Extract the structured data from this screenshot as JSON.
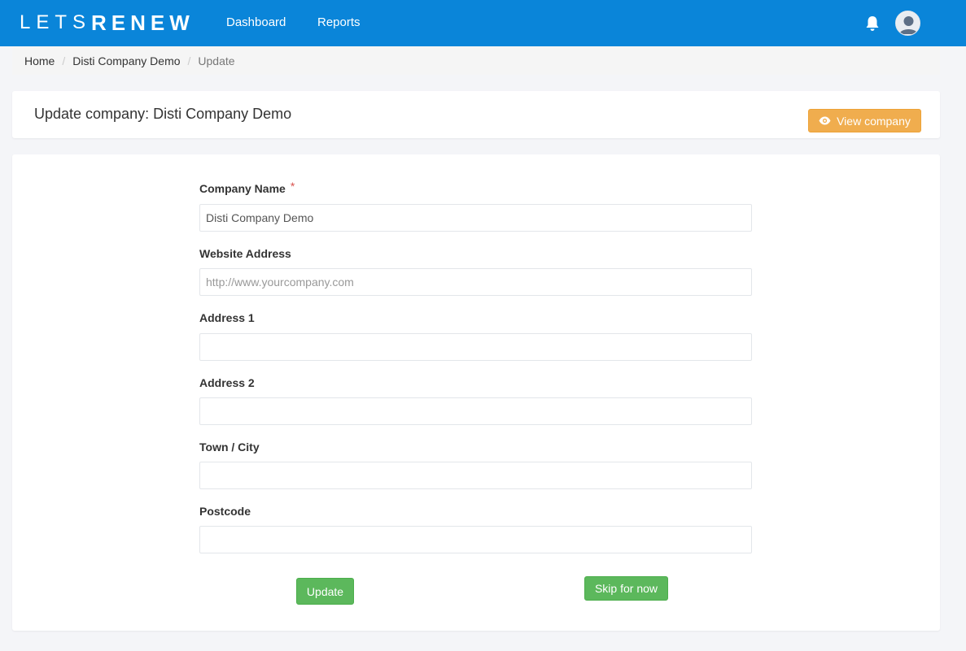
{
  "brand": {
    "part1": "LETS",
    "part2": "RENEW"
  },
  "nav": {
    "dashboard": "Dashboard",
    "reports": "Reports"
  },
  "icons": {
    "bell": "bell-icon",
    "avatar": "user-avatar-icon",
    "eye": "eye-icon"
  },
  "colors": {
    "navbar": "#0a85d9",
    "warning": "#f0ad4e",
    "success": "#5cb85c",
    "required": "#d9534f"
  },
  "breadcrumb": {
    "home": "Home",
    "company": "Disti Company Demo",
    "current": "Update"
  },
  "page": {
    "title": "Update company: Disti Company Demo",
    "view_button": "View company"
  },
  "form": {
    "company_name": {
      "label": "Company Name",
      "required_mark": "*",
      "value": "Disti Company Demo",
      "placeholder": ""
    },
    "website": {
      "label": "Website Address",
      "value": "",
      "placeholder": "http://www.yourcompany.com"
    },
    "address1": {
      "label": "Address 1",
      "value": "",
      "placeholder": ""
    },
    "address2": {
      "label": "Address 2",
      "value": "",
      "placeholder": ""
    },
    "town": {
      "label": "Town / City",
      "value": "",
      "placeholder": ""
    },
    "postcode": {
      "label": "Postcode",
      "value": "",
      "placeholder": ""
    }
  },
  "buttons": {
    "update": "Update",
    "skip": "Skip for now"
  }
}
